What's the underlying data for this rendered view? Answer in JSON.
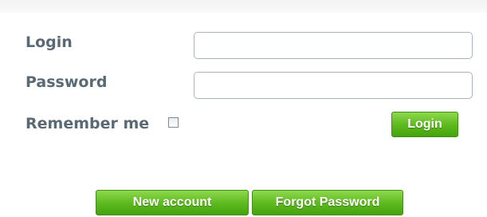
{
  "form": {
    "login_label": "Login",
    "password_label": "Password",
    "remember_label": "Remember me",
    "login_value": "",
    "password_value": "",
    "remember_checked": false
  },
  "buttons": {
    "login_label": "Login",
    "new_account_label": "New account",
    "forgot_password_label": "Forgot Password"
  },
  "colors": {
    "label_text": "#5a6a75",
    "button_green": "#5fbb1f",
    "input_border": "#a9b6c1"
  }
}
